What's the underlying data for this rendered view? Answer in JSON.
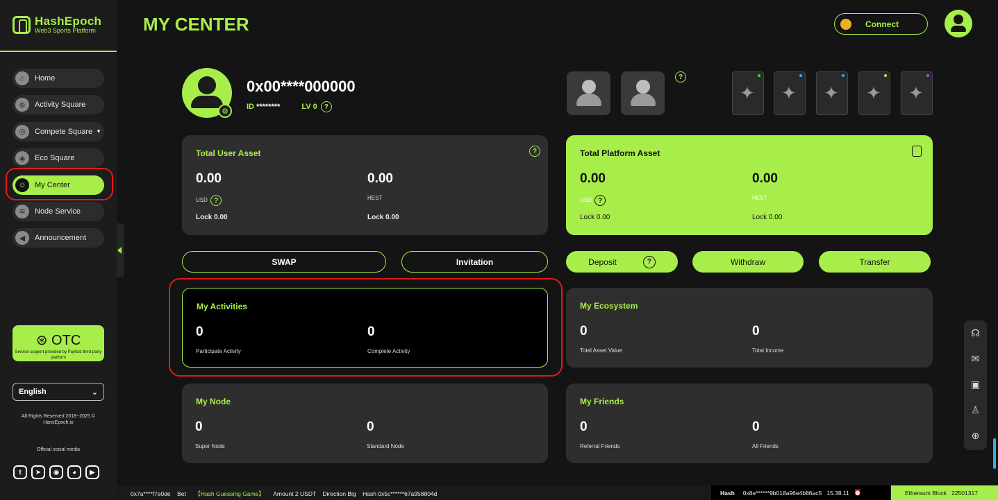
{
  "brand": {
    "name": "HashEpoch",
    "tagline": "Web3 Sports Platform"
  },
  "nav": [
    {
      "label": "Home",
      "icon": "home-icon"
    },
    {
      "label": "Activity Square",
      "icon": "grid-icon"
    },
    {
      "label": "Compete Square",
      "icon": "gamepad-icon"
    },
    {
      "label": "Eco Square",
      "icon": "eco-icon"
    },
    {
      "label": "My Center",
      "icon": "user-card-icon"
    },
    {
      "label": "Node Service",
      "icon": "node-icon"
    },
    {
      "label": "Announcement",
      "icon": "speaker-icon"
    }
  ],
  "otc": {
    "label": "OTC",
    "note": "Service support provided by Payfast third-party platform"
  },
  "language": "English",
  "footer": {
    "copyright": "All Rights Reserved 2018~2025 © HansEpoch.io",
    "social_title": "Official social media"
  },
  "header": {
    "title": "MY CENTER",
    "connect_label": "Connect"
  },
  "profile": {
    "address": "0x00****000000",
    "id_label": "ID",
    "id_value": "********",
    "level": "LV 0"
  },
  "user_asset": {
    "title": "Total User Asset",
    "usd_value": "0.00",
    "usd_label": "USD",
    "hest_value": "0.00",
    "hest_label": "HEST",
    "lock_usd": "Lock 0.00",
    "lock_hest": "Lock 0.00"
  },
  "platform_asset": {
    "title": "Total Platform Asset",
    "usd_value": "0.00",
    "usd_label": "USD",
    "hest_value": "0.00",
    "hest_label": "HEST",
    "lock_usd": "Lock 0.00",
    "lock_hest": "Lock 0.00"
  },
  "actions": {
    "swap": "SWAP",
    "invitation": "Invitation",
    "deposit": "Deposit",
    "withdraw": "Withdraw",
    "transfer": "Transfer"
  },
  "activities": {
    "title": "My Activities",
    "participate": "0",
    "participate_label": "Participate Activity",
    "complete": "0",
    "complete_label": "Complete Activity"
  },
  "ecosystem": {
    "title": "My Ecosystem",
    "asset": "0",
    "asset_label": "Total Asset Value",
    "income": "0",
    "income_label": "Total Income"
  },
  "node": {
    "title": "My Node",
    "super": "0",
    "super_label": "Super Node",
    "standard": "0",
    "standard_label": "Standard Node"
  },
  "friends": {
    "title": "My Friends",
    "referral": "0",
    "referral_label": "Referral Friends",
    "all": "0",
    "all_label": "All Friends"
  },
  "ticker": {
    "addr": "0x7a****f7e0de",
    "bet": "Bet",
    "game": "【Hash Guessing Game】",
    "amount": "Amount 2 USDT",
    "direction": "Direction Big",
    "hash_text": "Hash 0x5c******67a958804d",
    "hash_label": "Hash",
    "hash_value": "0x8e******9b018a96e4b86ac5",
    "time": "15.38.11",
    "eth_label": "Ethereum Block",
    "eth_block": "22501317"
  },
  "colors": {
    "accent": "#a8ee4a",
    "background": "#141414",
    "card": "#2e2e2e",
    "highlight": "#e21a1a"
  }
}
